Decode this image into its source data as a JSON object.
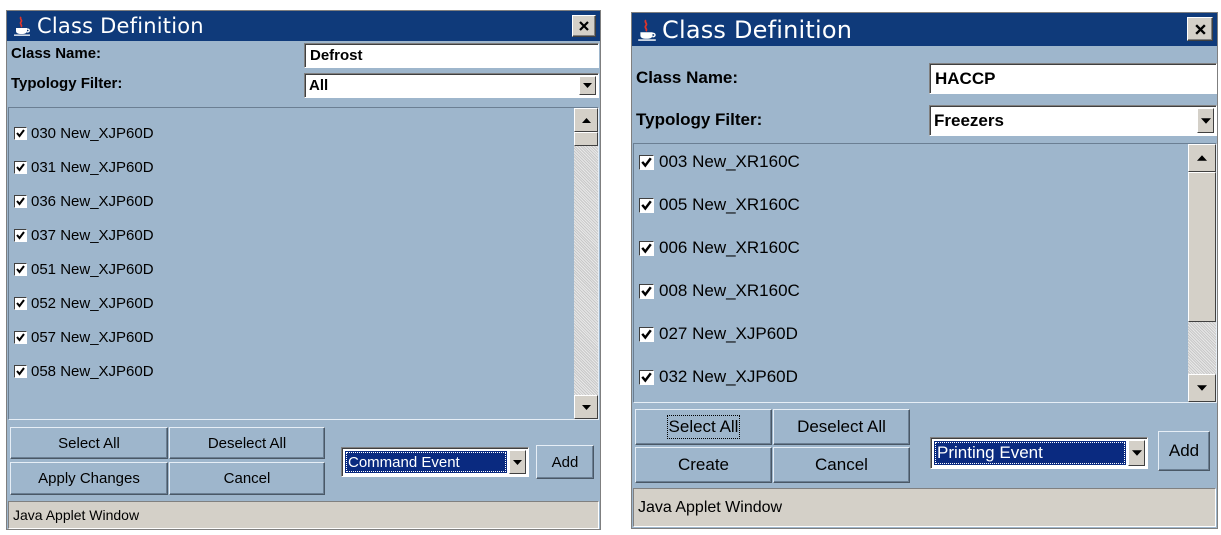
{
  "left": {
    "title": "Class Definition",
    "class_name_label": "Class Name:",
    "class_name_value": "Defrost",
    "typology_label": "Typology Filter:",
    "typology_value": "All",
    "items": [
      {
        "label": "030 New_XJP60D",
        "checked": true
      },
      {
        "label": "031 New_XJP60D",
        "checked": true
      },
      {
        "label": "036 New_XJP60D",
        "checked": true
      },
      {
        "label": "037 New_XJP60D",
        "checked": true
      },
      {
        "label": "051 New_XJP60D",
        "checked": true
      },
      {
        "label": "052 New_XJP60D",
        "checked": true
      },
      {
        "label": "057 New_XJP60D",
        "checked": true
      },
      {
        "label": "058 New_XJP60D",
        "checked": true
      }
    ],
    "buttons": {
      "select_all": "Select All",
      "deselect_all": "Deselect All",
      "apply": "Apply Changes",
      "cancel": "Cancel",
      "add": "Add"
    },
    "event_value": "Command Event",
    "status": "Java Applet Window"
  },
  "right": {
    "title": "Class Definition",
    "class_name_label": "Class Name:",
    "class_name_value": "HACCP",
    "typology_label": "Typology Filter:",
    "typology_value": "Freezers",
    "items": [
      {
        "label": "003 New_XR160C",
        "checked": true
      },
      {
        "label": "005 New_XR160C",
        "checked": true
      },
      {
        "label": "006 New_XR160C",
        "checked": true
      },
      {
        "label": "008 New_XR160C",
        "checked": true
      },
      {
        "label": "027 New_XJP60D",
        "checked": true
      },
      {
        "label": "032 New_XJP60D",
        "checked": true
      }
    ],
    "buttons": {
      "select_all": "Select All",
      "deselect_all": "Deselect All",
      "create": "Create",
      "cancel": "Cancel",
      "add": "Add"
    },
    "event_value": "Printing Event",
    "status": "Java Applet Window"
  },
  "icons": {
    "app": "java-cup-icon",
    "close": "close-icon",
    "check": "checkmark-icon",
    "combo": "triangle-down-icon",
    "scroll_up": "triangle-up-icon",
    "scroll_down": "triangle-down-icon"
  },
  "colors": {
    "title_bg": "#0f3a7a",
    "panel_bg": "#9eb6cc",
    "selection_bg": "#0a2a80"
  }
}
